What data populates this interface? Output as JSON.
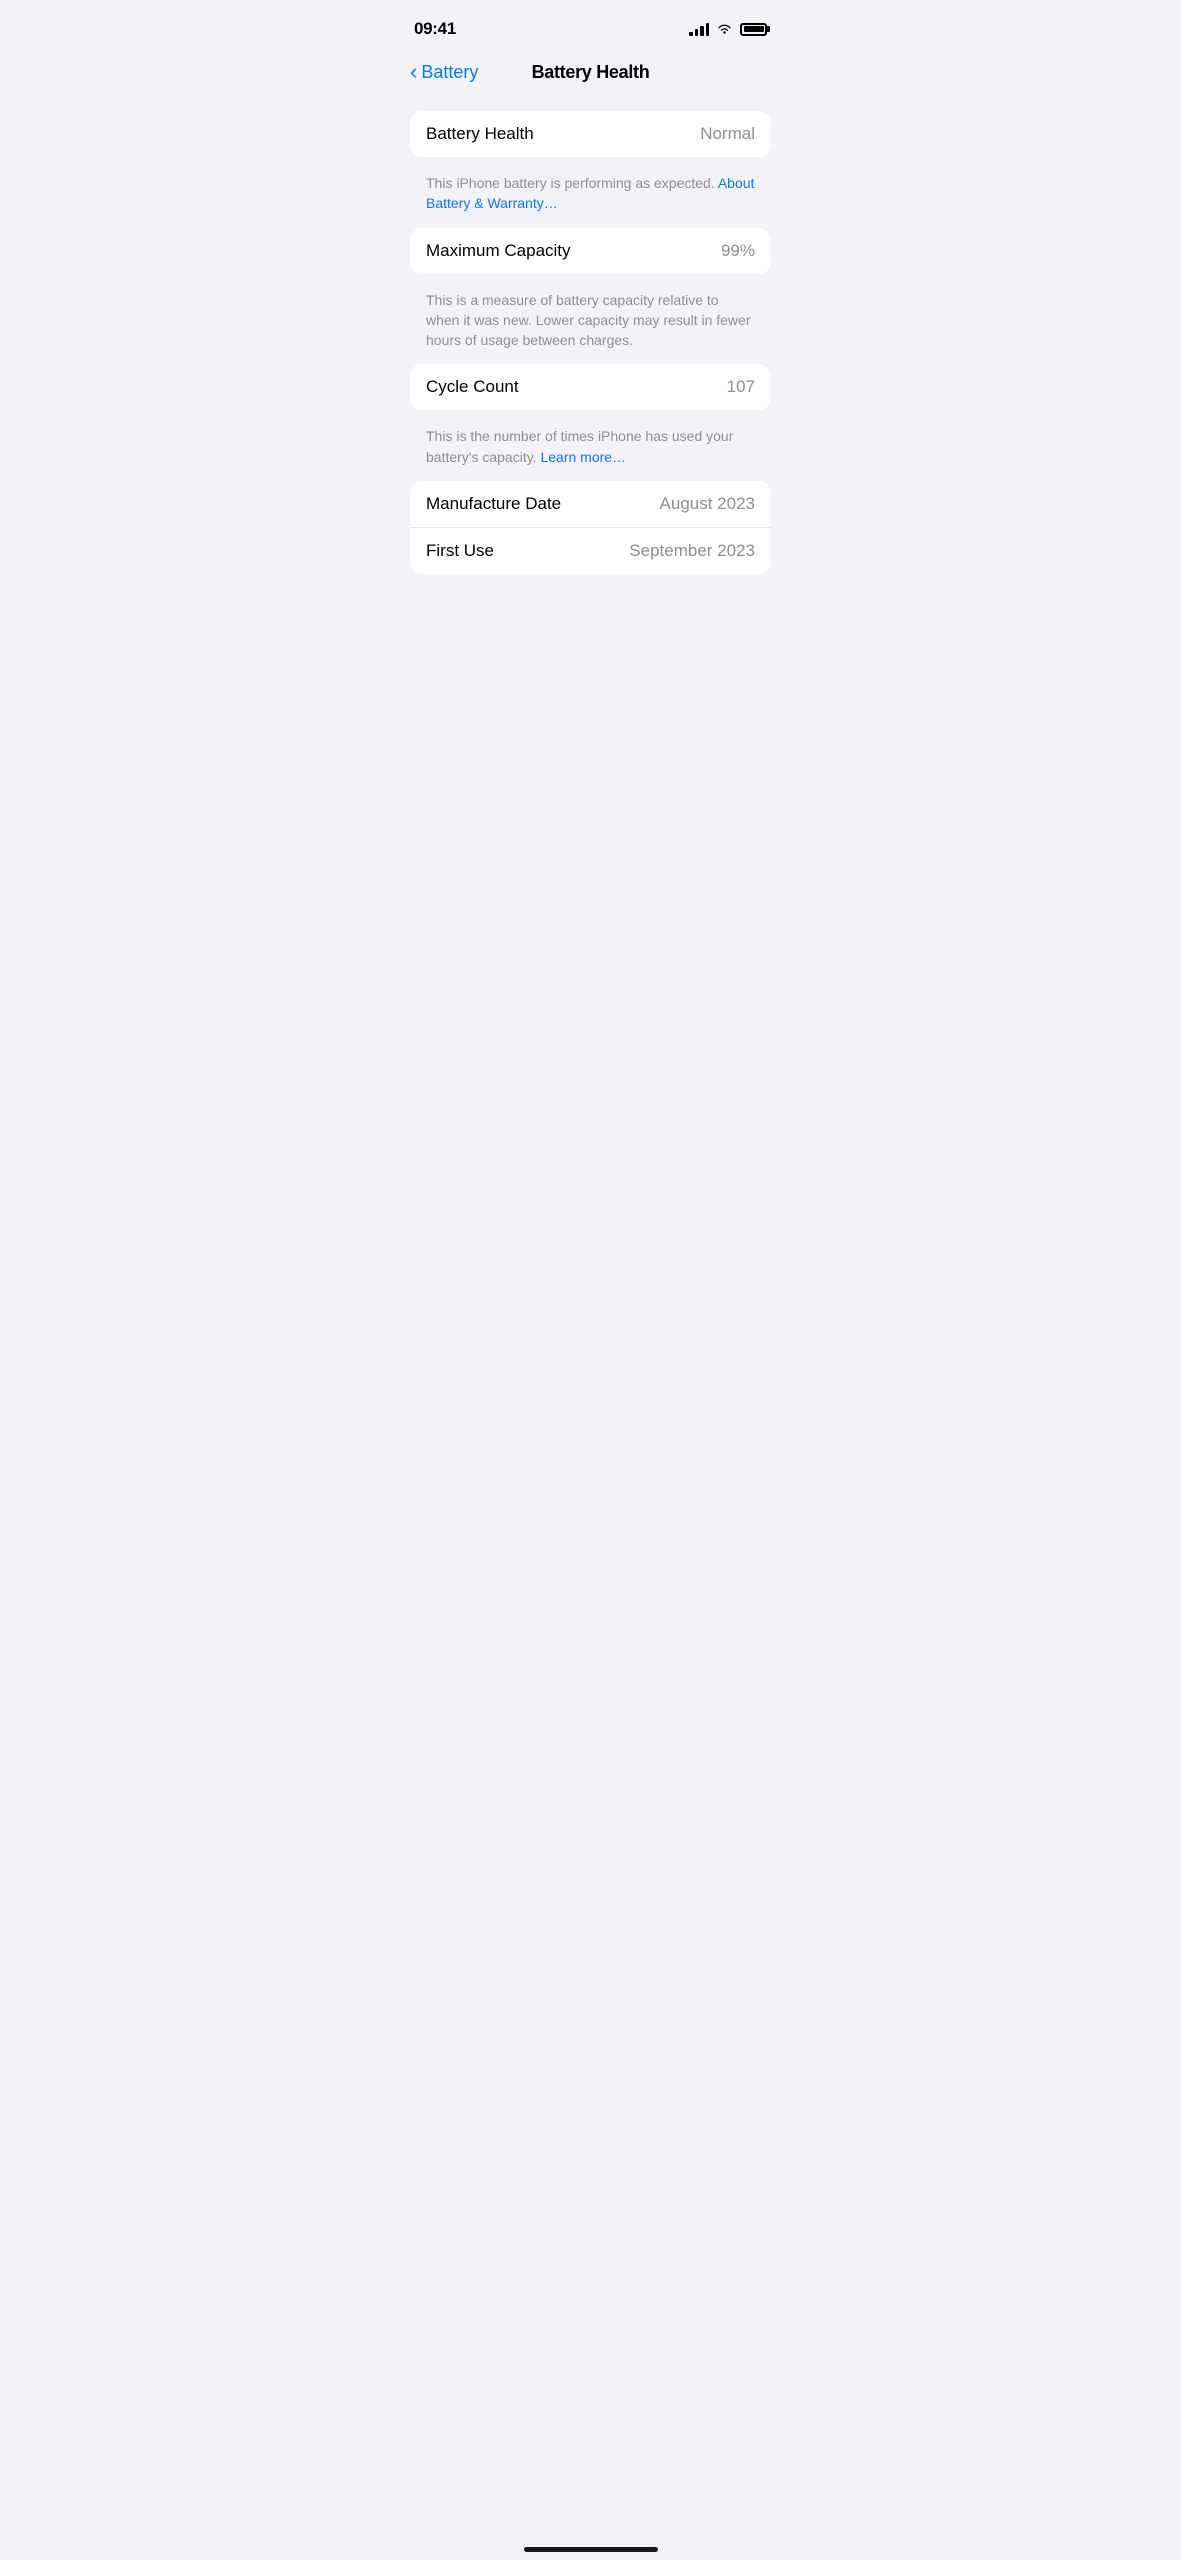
{
  "statusBar": {
    "time": "09:41",
    "batteryFill": "100%"
  },
  "nav": {
    "backLabel": "Battery",
    "title": "Battery Health"
  },
  "sections": {
    "batteryHealth": {
      "label": "Battery Health",
      "value": "Normal",
      "description": "This iPhone battery is performing as expected. ",
      "linkText": "About Battery & Warranty…"
    },
    "maximumCapacity": {
      "label": "Maximum Capacity",
      "value": "99%",
      "description": "This is a measure of battery capacity relative to when it was new. Lower capacity may result in fewer hours of usage between charges."
    },
    "cycleCount": {
      "label": "Cycle Count",
      "value": "107",
      "description": "This is the number of times iPhone has used your battery's capacity. ",
      "linkText": "Learn more…"
    },
    "dates": {
      "manufactureLabel": "Manufacture Date",
      "manufactureValue": "August 2023",
      "firstUseLabel": "First Use",
      "firstUseValue": "September 2023"
    }
  }
}
